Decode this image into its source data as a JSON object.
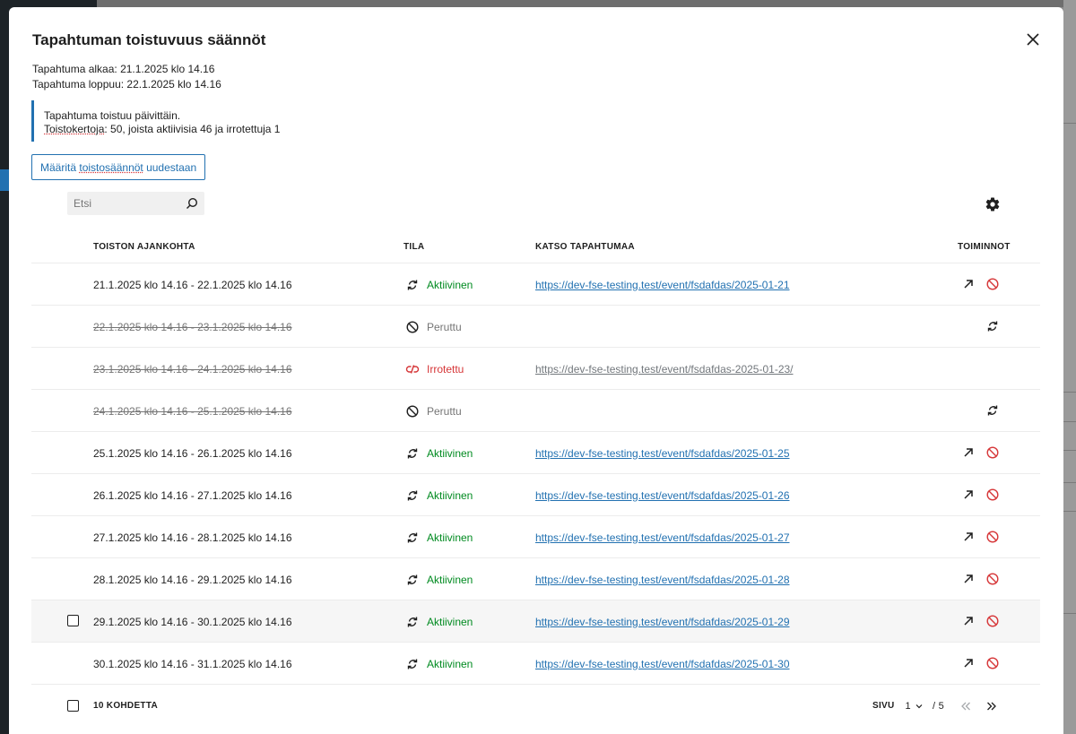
{
  "modal": {
    "title": "Tapahtuman toistuvuus säännöt",
    "start_text": "Tapahtuma alkaa: 21.1.2025 klo 14.16",
    "end_text": "Tapahtuma loppuu: 22.1.2025 klo 14.16",
    "notice_line1": "Tapahtuma toistuu päivittäin.",
    "notice_line2_prefix": "Toistokertoja",
    "notice_line2_rest": ": 50, joista aktiivisia 46 ja irrotettuja 1",
    "redefine_prefix": "Määritä ",
    "redefine_underlined": "toistosäännöt",
    "redefine_suffix": " uudestaan"
  },
  "search": {
    "placeholder": "Etsi"
  },
  "table": {
    "headers": {
      "time": "Toiston ajankohta",
      "status": "Tila",
      "view": "Katso tapahtumaa",
      "actions": "Toiminnot"
    },
    "rows": [
      {
        "time": "21.1.2025 klo 14.16 - 22.1.2025 klo 14.16",
        "status": "Aktiivinen",
        "state": "active",
        "link": "https://dev-fse-testing.test/event/fsdafdas/2025-01-21"
      },
      {
        "time": "22.1.2025 klo 14.16 - 23.1.2025 klo 14.16",
        "status": "Peruttu",
        "state": "cancelled",
        "link": ""
      },
      {
        "time": "23.1.2025 klo 14.16 - 24.1.2025 klo 14.16",
        "status": "Irrotettu",
        "state": "detached",
        "link": "https://dev-fse-testing.test/event/fsdafdas-2025-01-23/"
      },
      {
        "time": "24.1.2025 klo 14.16 - 25.1.2025 klo 14.16",
        "status": "Peruttu",
        "state": "cancelled",
        "link": ""
      },
      {
        "time": "25.1.2025 klo 14.16 - 26.1.2025 klo 14.16",
        "status": "Aktiivinen",
        "state": "active",
        "link": "https://dev-fse-testing.test/event/fsdafdas/2025-01-25"
      },
      {
        "time": "26.1.2025 klo 14.16 - 27.1.2025 klo 14.16",
        "status": "Aktiivinen",
        "state": "active",
        "link": "https://dev-fse-testing.test/event/fsdafdas/2025-01-26"
      },
      {
        "time": "27.1.2025 klo 14.16 - 28.1.2025 klo 14.16",
        "status": "Aktiivinen",
        "state": "active",
        "link": "https://dev-fse-testing.test/event/fsdafdas/2025-01-27"
      },
      {
        "time": "28.1.2025 klo 14.16 - 29.1.2025 klo 14.16",
        "status": "Aktiivinen",
        "state": "active",
        "link": "https://dev-fse-testing.test/event/fsdafdas/2025-01-28"
      },
      {
        "time": "29.1.2025 klo 14.16 - 30.1.2025 klo 14.16",
        "status": "Aktiivinen",
        "state": "active",
        "link": "https://dev-fse-testing.test/event/fsdafdas/2025-01-29"
      },
      {
        "time": "30.1.2025 klo 14.16 - 31.1.2025 klo 14.16",
        "status": "Aktiivinen",
        "state": "active",
        "link": "https://dev-fse-testing.test/event/fsdafdas/2025-01-30"
      }
    ]
  },
  "footer": {
    "count_label": "10 kohdetta",
    "page_label": "Sivu",
    "current_page": "1",
    "total_pages": "/ 5"
  },
  "colors": {
    "accent": "#2271b1",
    "active": "#008a20",
    "detached": "#d63638",
    "muted": "#757575"
  },
  "icons": {
    "close": "close-icon",
    "search": "search-icon",
    "settings": "gear-icon",
    "active_status": "repeat-icon",
    "cancelled_status": "cancel-circle-icon",
    "detached_status": "unlink-icon",
    "open": "arrow-up-right-icon",
    "cancel_action": "cancel-circle-icon",
    "restore_action": "repeat-icon",
    "first_page": "double-chevron-left-icon",
    "next_page": "double-chevron-right-icon"
  }
}
